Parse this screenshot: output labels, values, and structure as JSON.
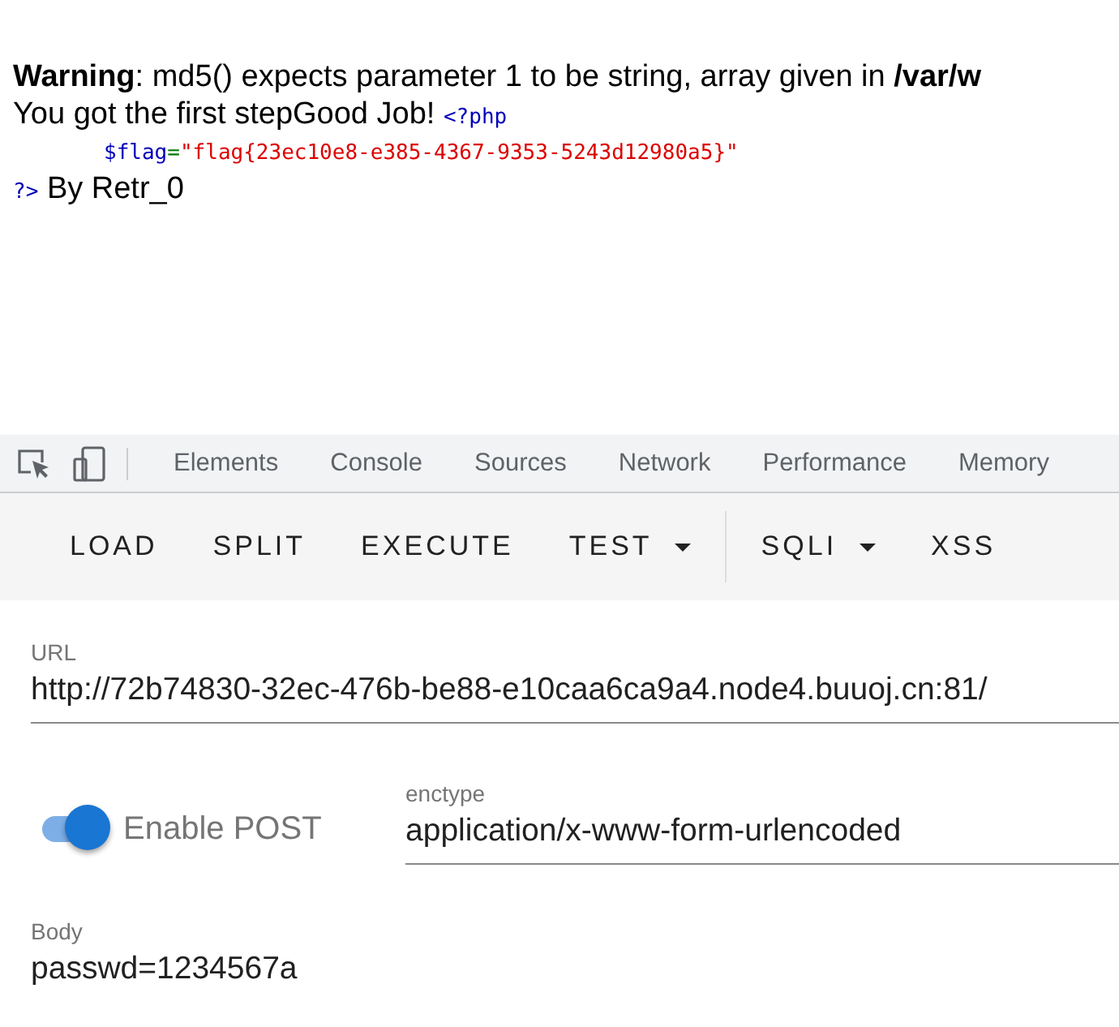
{
  "output": {
    "warnings": [
      "**Warning**: md5() expects parameter 1 to be string, array given in **/var/w**"
    ],
    "message": "You got the first stepGood Job!",
    "code": {
      "open": "<?php",
      "variable": "$flag",
      "operator": "=",
      "string": "\"flag{23ec10e8-e385-4367-9353-5243d12980a5}\"",
      "close": "?>"
    },
    "trailer": "By Retr_0"
  },
  "devtools": {
    "tabs": [
      "Elements",
      "Console",
      "Sources",
      "Network",
      "Performance",
      "Memory"
    ]
  },
  "hackbar": {
    "buttons": [
      {
        "label": "LOAD",
        "kind": "button"
      },
      {
        "label": "SPLIT",
        "kind": "button"
      },
      {
        "label": "EXECUTE",
        "kind": "button"
      },
      {
        "label": "TEST",
        "kind": "menu"
      },
      {
        "label": "SQLI",
        "kind": "menu"
      },
      {
        "label": "XSS",
        "kind": "button"
      }
    ],
    "url": {
      "label": "URL",
      "value": "http://72b74830-32ec-476b-be88-e10caa6ca9a4.node4.buuoj.cn:81/"
    },
    "post": {
      "label": "Enable POST",
      "on": true
    },
    "enctype": {
      "label": "enctype",
      "value": "application/x-www-form-urlencoded"
    },
    "body": {
      "label": "Body",
      "value": "passwd=1234567a"
    }
  }
}
